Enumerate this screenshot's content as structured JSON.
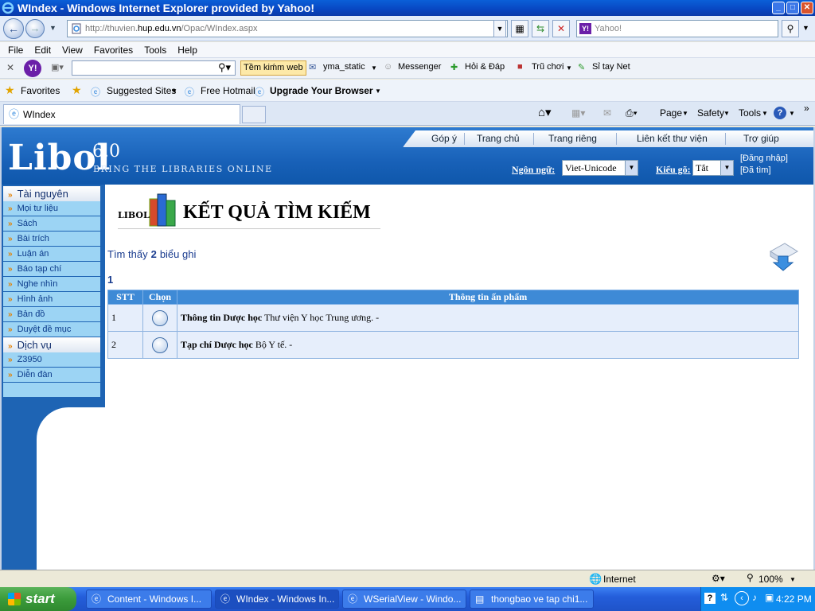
{
  "window": {
    "title": "WIndex - Windows Internet Explorer provided by Yahoo!"
  },
  "nav": {
    "address": "http://thuvien.hup.edu.vn/Opac/WIndex.aspx",
    "address_host": "hup.edu.vn",
    "search_placeholder": "Yahoo!"
  },
  "menu": [
    "File",
    "Edit",
    "View",
    "Favorites",
    "Tools",
    "Help"
  ],
  "ytoolbar": {
    "search_button": "Tềm kiḿm web",
    "items": [
      "yma_static",
      "Messenger",
      "Hỏi & Đáp",
      "Trũ chơi",
      "Sỉ tay Net"
    ]
  },
  "favbar": {
    "favorites": "Favorites",
    "suggested": "Suggested Sites",
    "hotmail": "Free Hotmail",
    "upgrade": "Upgrade Your Browser"
  },
  "tabs": {
    "active": "WIndex",
    "cmd_page": "Page",
    "cmd_safety": "Safety",
    "cmd_tools": "Tools"
  },
  "site": {
    "top_links": [
      "Góp ý",
      "Trang chủ",
      "Trang riêng",
      "Liên kết thư viện",
      "Trợ giúp"
    ],
    "logo": "Libol",
    "version": "6.0",
    "slogan": "BRING THE LIBRARIES ONLINE",
    "lang_label": "Ngôn ngữ:",
    "lang_value": "Viet-Unicode",
    "typing_label": "Kiểu gõ:",
    "typing_value": "Tắt",
    "login": "[Đăng nhập]",
    "searched": "[Đã tìm]"
  },
  "sidebar": {
    "resources_title": "Tài nguyên",
    "resources": [
      "Mọi tư liệu",
      "Sách",
      "Bài trích",
      "Luận án",
      "Báo tạp chí",
      "Nghe nhìn",
      "Hình ảnh",
      "Bản đồ",
      "Duyệt đề mục"
    ],
    "services_title": "Dịch vụ",
    "services": [
      "Z3950",
      "Diễn đàn"
    ]
  },
  "content": {
    "title_small": "LIBOL",
    "title": "KẾT QUẢ TÌM KIẾM",
    "found_prefix": "Tìm thấy",
    "found_count": "2",
    "found_suffix": "biểu ghi",
    "page": "1",
    "columns": [
      "STT",
      "Chọn",
      "Thông tin ấn phẩm"
    ],
    "rows": [
      {
        "stt": "1",
        "title": "Thông tin Dược học",
        "info": "Thư viện Y học Trung ương. -"
      },
      {
        "stt": "2",
        "title": "Tạp chí Dược học",
        "info": "Bộ Y tế. -"
      }
    ]
  },
  "status": {
    "zone": "Internet",
    "zoom": "100%"
  },
  "taskbar": {
    "start": "start",
    "tasks": [
      "Content - Windows I...",
      "WIndex - Windows In...",
      "WSerialView - Windo...",
      "thongbao ve tap chi1..."
    ],
    "clock": "4:22 PM"
  }
}
